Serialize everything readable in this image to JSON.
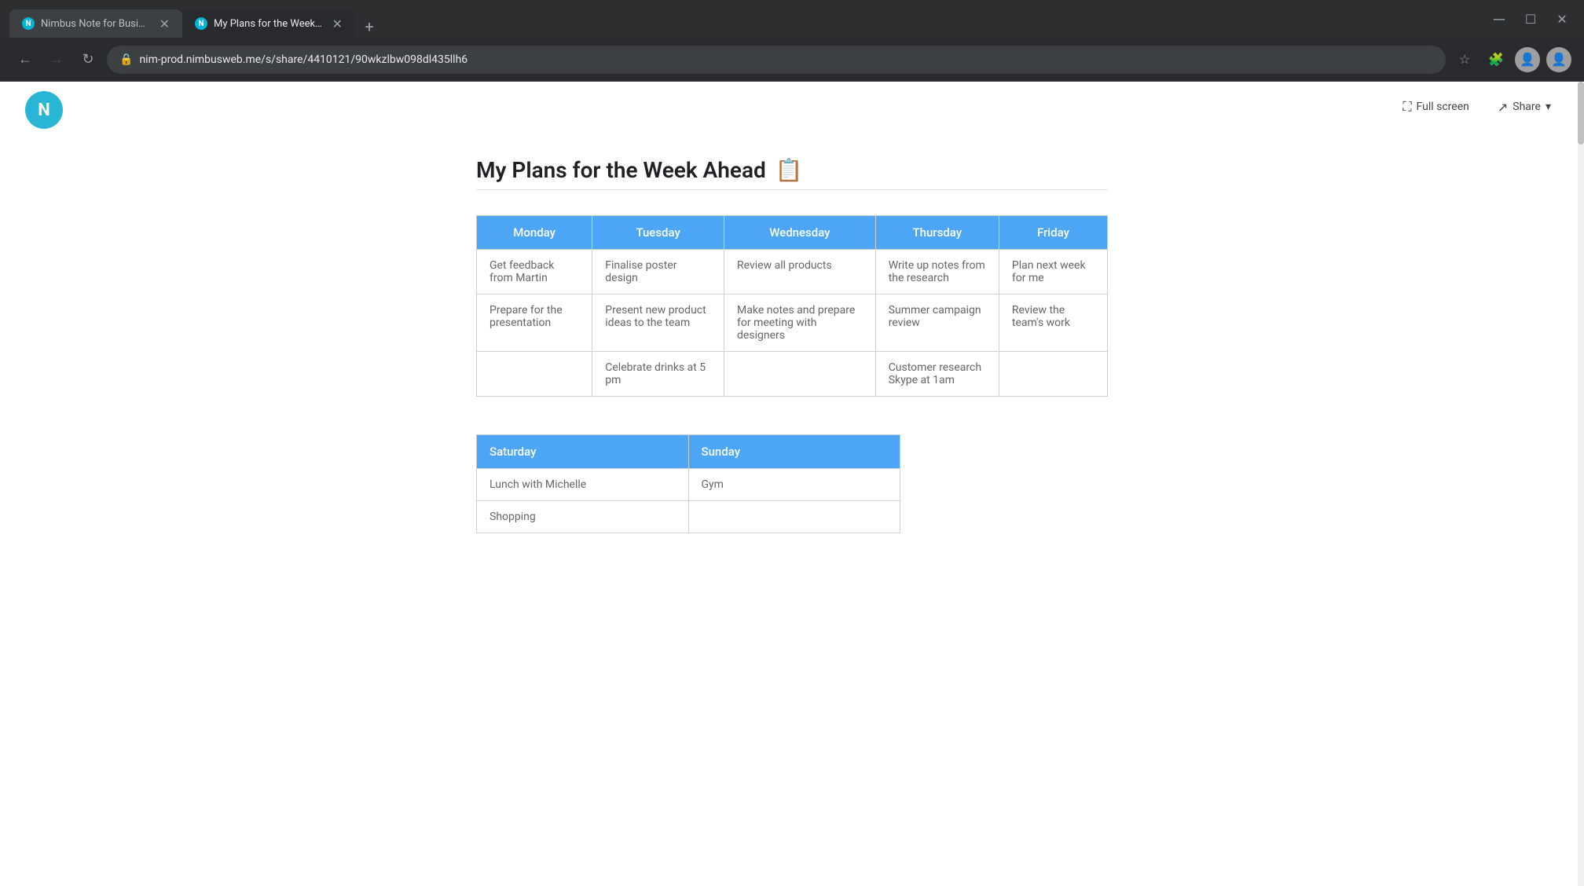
{
  "browser": {
    "tabs": [
      {
        "id": "tab1",
        "title": "Nimbus Note for Business - Org...",
        "icon": "N",
        "active": false,
        "closable": true
      },
      {
        "id": "tab2",
        "title": "My Plans for the Week Ahead",
        "icon": "N",
        "active": true,
        "closable": true
      }
    ],
    "new_tab_label": "+",
    "address": "nim-prod.nimbusweb.me/s/share/4410121/90wkzlbw098dl435llh6",
    "back_disabled": false,
    "forward_disabled": true
  },
  "page": {
    "fullscreen_label": "Full screen",
    "share_label": "Share",
    "title": "My Plans for the Week Ahead",
    "title_icon": "📋"
  },
  "weekday_table": {
    "headers": [
      "Monday",
      "Tuesday",
      "Wednesday",
      "Thursday",
      "Friday"
    ],
    "rows": [
      [
        "Get feedback from Martin",
        "Finalise poster design",
        "Review all products",
        "Write up notes from the research",
        "Plan next week for me"
      ],
      [
        "Prepare for the presentation",
        "Present new product ideas to the team",
        "Make notes and prepare for meeting with designers",
        "Summer campaign review",
        "Review the team's work"
      ],
      [
        "",
        "Celebrate drinks at 5 pm",
        "",
        "Customer research Skype at 1am",
        ""
      ]
    ]
  },
  "weekend_table": {
    "headers": [
      "Saturday",
      "Sunday"
    ],
    "rows": [
      [
        "Lunch with Michelle",
        "Gym"
      ],
      [
        "Shopping",
        ""
      ]
    ]
  }
}
